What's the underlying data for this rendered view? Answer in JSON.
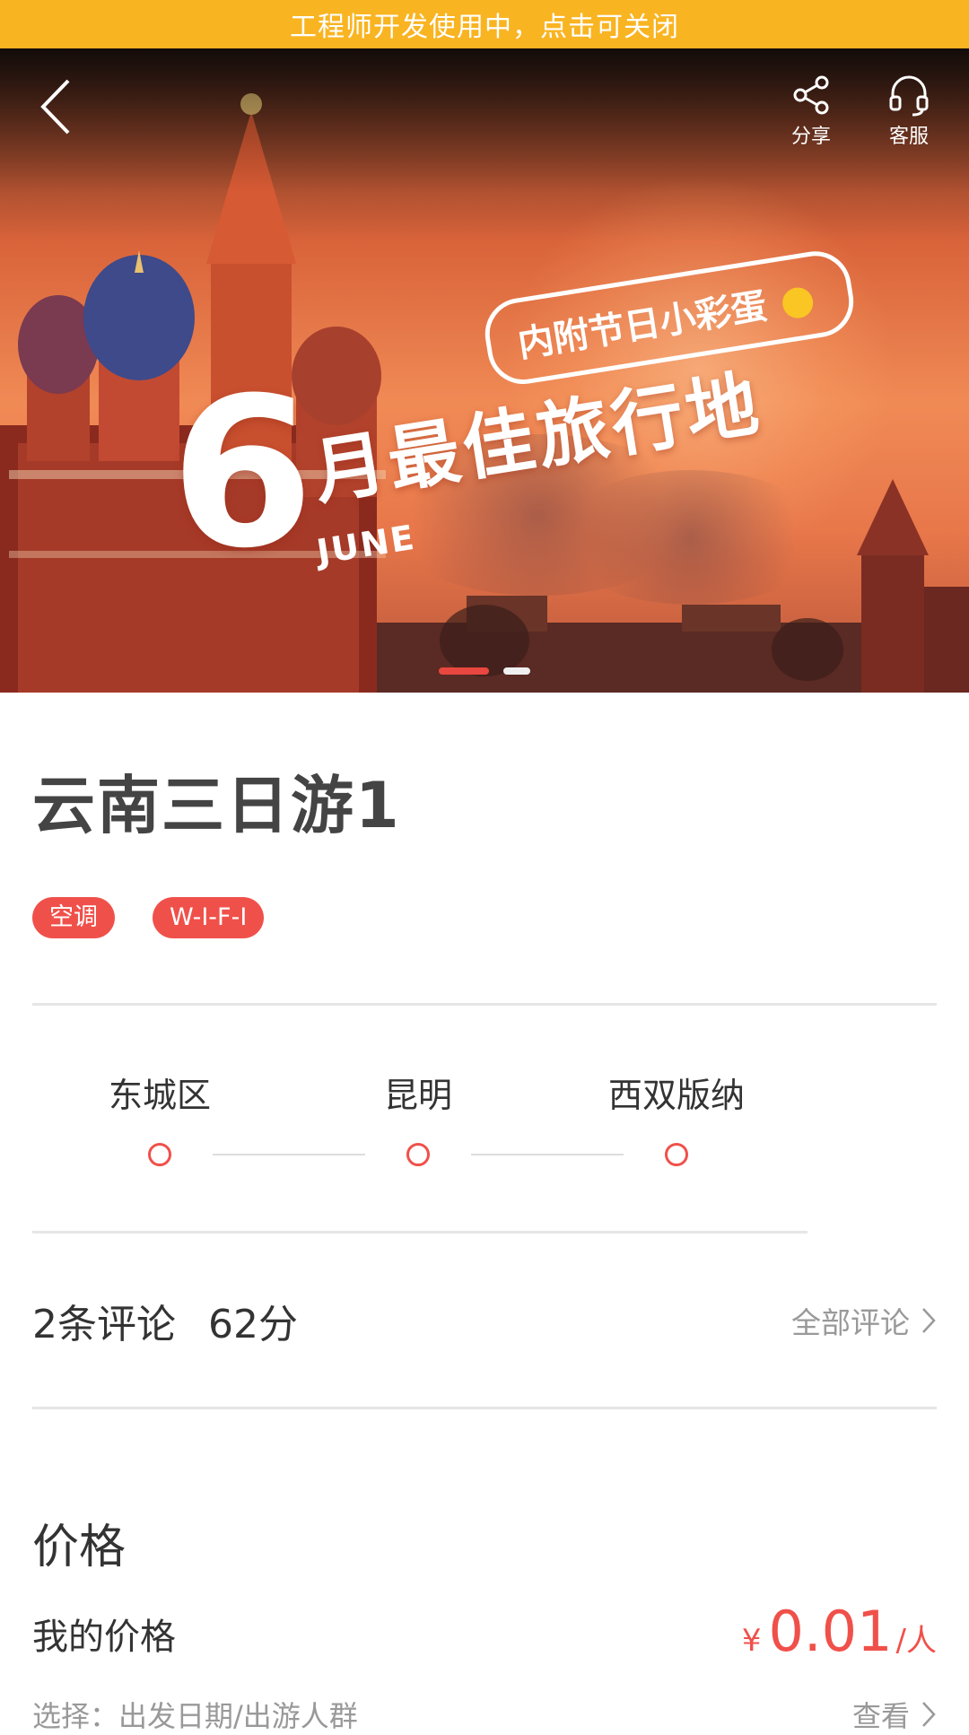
{
  "dev_banner": {
    "text": "工程师开发使用中，点击可关闭"
  },
  "hero": {
    "tag_text": "内附节日小彩蛋",
    "big_number": "6",
    "headline": "月最佳旅行地",
    "month_label": "JUNE",
    "nav": {
      "share_label": "分享",
      "service_label": "客服"
    },
    "carousel": {
      "total": 2,
      "active": 1
    }
  },
  "product": {
    "title": "云南三日游1",
    "tags": [
      "空调",
      "W-I-F-I"
    ]
  },
  "route": {
    "stops": [
      "东城区",
      "昆明",
      "西双版纳"
    ]
  },
  "reviews": {
    "count_label": "2条评论",
    "score_label": "62分",
    "all_link": "全部评论"
  },
  "price": {
    "heading": "价格",
    "my_price_label": "我的价格",
    "currency": "¥",
    "value": "0.01",
    "unit": "/人",
    "select_label": "选择：出发日期/出游人群",
    "view_link": "查看"
  },
  "colors": {
    "banner": "#F9B422",
    "accent": "#F0504A"
  }
}
